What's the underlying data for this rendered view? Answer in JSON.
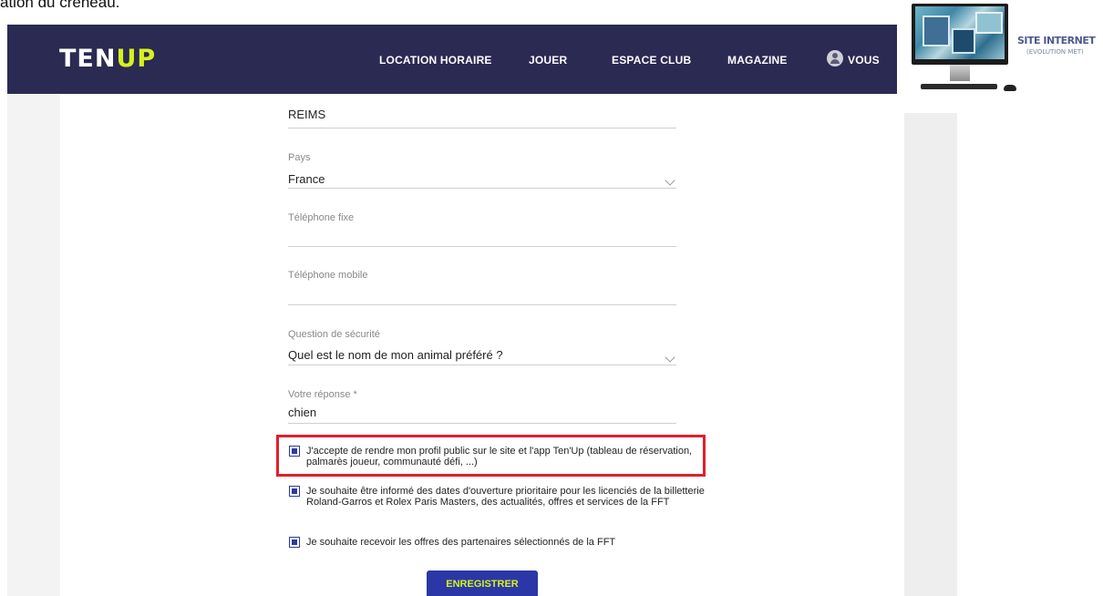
{
  "caption": "ation du créneau.",
  "nav": {
    "logo_ten": "TEN",
    "logo_up": "UP",
    "items": [
      "LOCATION HORAIRE",
      "JOUER",
      "ESPACE CLUB",
      "MAGAZINE"
    ],
    "user": "VOUS"
  },
  "form": {
    "city_value": "REIMS",
    "country_label": "Pays",
    "country_value": "France",
    "phone_fixed_label": "Téléphone fixe",
    "phone_fixed_value": "",
    "phone_mobile_label": "Téléphone mobile",
    "phone_mobile_value": "",
    "security_question_label": "Question de sécurité",
    "security_question_value": "Quel est le nom de mon animal préféré ?",
    "answer_label": "Votre réponse *",
    "answer_value": "chien",
    "checkboxes": [
      {
        "checked": true,
        "text": "J'accepte de rendre mon profil public sur le site et l'app Ten'Up (tableau de réservation, palmarès joueur, communauté défi, ...)"
      },
      {
        "checked": true,
        "text": "Je souhaite être informé des dates d'ouverture prioritaire pour les licenciés de la billetterie Roland-Garros et Rolex Paris Masters, des actualités, offres et services de la FFT"
      },
      {
        "checked": true,
        "text": "Je souhaite recevoir les offres des partenaires sélectionnés de la FFT"
      }
    ],
    "save_label": "ENREGISTRER"
  },
  "side": {
    "title": "SITE INTERNET",
    "subtitle": "(EVOLUTION MET)"
  },
  "colors": {
    "navbar": "#2a2a53",
    "accent_yellow": "#d6f21d",
    "button": "#2b37a6",
    "highlight": "#e0202b"
  }
}
